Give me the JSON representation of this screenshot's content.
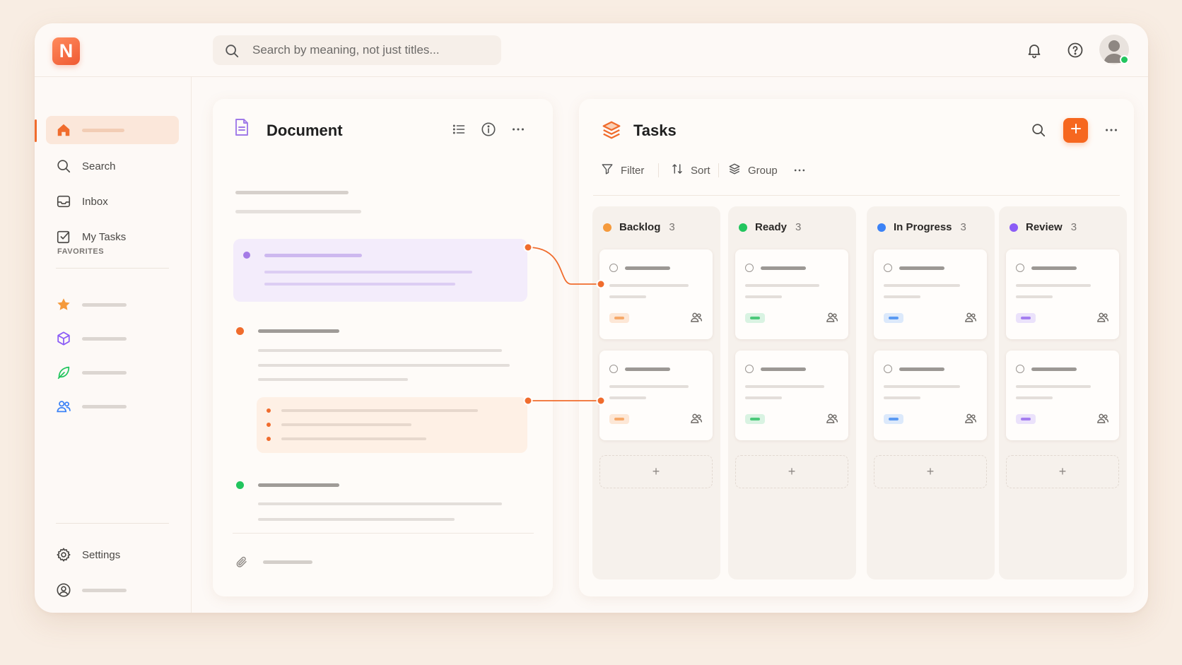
{
  "app": {
    "logo_letter": "N",
    "accent": "#f06c2d"
  },
  "search": {
    "placeholder": "Search by meaning, not just titles..."
  },
  "sidebar": {
    "items": [
      {
        "label": "",
        "icon": "home-icon"
      },
      {
        "label": "Search",
        "icon": "search-icon"
      },
      {
        "label": "Inbox",
        "icon": "inbox-icon"
      },
      {
        "label": "My Tasks",
        "icon": "checkbox-icon"
      }
    ],
    "favorites_label": "FAVORITES",
    "favorites": [
      {
        "icon": "star-icon",
        "color": "#f59a3c"
      },
      {
        "icon": "cube-icon",
        "color": "#8b5cf6"
      },
      {
        "icon": "leaf-icon",
        "color": "#22c55e"
      },
      {
        "icon": "team-icon",
        "color": "#3b82f6"
      }
    ],
    "settings_label": "Settings"
  },
  "document": {
    "title": "Document"
  },
  "tasks": {
    "title": "Tasks",
    "toolbar": {
      "filter_label": "Filter",
      "sort_label": "Sort",
      "group_label": "Group"
    },
    "columns": [
      {
        "name": "Backlog",
        "count": "3",
        "color": "#f59a3c",
        "tag_color": "#f6a96a",
        "tag_bg": "#fde7d6"
      },
      {
        "name": "Ready",
        "count": "3",
        "color": "#22c55e",
        "tag_color": "#4cc97a",
        "tag_bg": "#d9f3e2"
      },
      {
        "name": "In Progress",
        "count": "3",
        "color": "#3b82f6",
        "tag_color": "#5b9af2",
        "tag_bg": "#dce9fb"
      },
      {
        "name": "Review",
        "count": "3",
        "color": "#8b5cf6",
        "tag_color": "#a57ef0",
        "tag_bg": "#ebe2fb"
      }
    ],
    "add_card_label": "+"
  }
}
